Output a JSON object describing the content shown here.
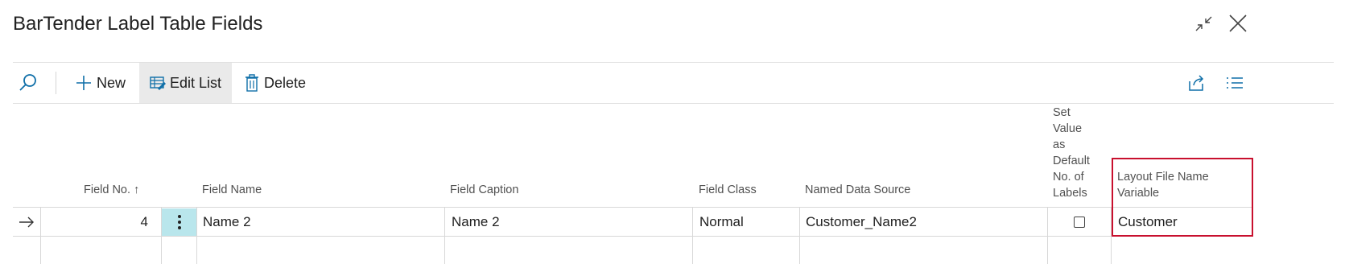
{
  "page": {
    "title": "BarTender Label Table Fields",
    "window_icons": [
      "collapse-icon",
      "close-icon"
    ]
  },
  "toolbar": {
    "search_icon": "search-icon",
    "new_label": "New",
    "edit_list_label": "Edit List",
    "delete_label": "Delete",
    "share_icon": "share-icon",
    "list_view_icon": "list-view-icon",
    "active_item": "Edit List"
  },
  "columns": {
    "field_no": "Field No. ↑",
    "field_name": "Field Name",
    "field_caption": "Field Caption",
    "field_class": "Field Class",
    "named_data_source": "Named Data Source",
    "set_value_default_labels": [
      "Set",
      "Value",
      "as",
      "Default",
      "No. of",
      "Labels"
    ],
    "layout_file_name_variable": [
      "Layout File Name",
      "Variable"
    ]
  },
  "rows": [
    {
      "indicator_icon": "arrow-right-icon",
      "field_no": "4",
      "field_name": "Name 2",
      "field_caption": "Name 2",
      "field_class": "Normal",
      "named_data_source": "Customer_Name2",
      "set_value_default_checked": false,
      "layout_file_name_variable": "Customer"
    }
  ],
  "colors": {
    "accent": "#0f6fa8",
    "highlight_border": "#c8102e",
    "row_menu_bg": "#b9e6ec",
    "toolbar_active_bg": "#eaeaea"
  }
}
